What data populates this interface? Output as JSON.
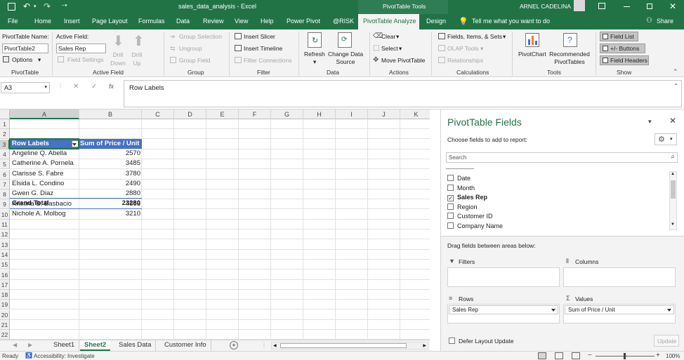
{
  "titlebar": {
    "title": "sales_data_analysis  -  Excel",
    "context": "PivotTable Tools",
    "user": "ARNEL CADELINA"
  },
  "tabs": [
    "File",
    "Home",
    "Insert",
    "Page Layout",
    "Formulas",
    "Data",
    "Review",
    "View",
    "Help",
    "Power Pivot",
    "@RISK",
    "PivotTable Analyze",
    "Design"
  ],
  "active_tab": "PivotTable Analyze",
  "tell_me": "Tell me what you want to do",
  "share": "Share",
  "ribbon": {
    "pivottable": {
      "name_label": "PivotTable Name:",
      "name_value": "PivotTable2",
      "options": "Options",
      "group": "PivotTable"
    },
    "active_field": {
      "label": "Active Field:",
      "value": "Sales Rep",
      "field_settings": "Field Settings",
      "drill_down": "Drill Down",
      "drill_up": "Drill Up",
      "group": "Active Field"
    },
    "group": {
      "group_selection": "Group Selection",
      "ungroup": "Ungroup",
      "group_field": "Group Field",
      "group": "Group"
    },
    "filter": {
      "insert_slicer": "Insert Slicer",
      "insert_timeline": "Insert Timeline",
      "filter_connections": "Filter Connections",
      "group": "Filter"
    },
    "data": {
      "refresh": "Refresh",
      "change_source": "Change Data Source",
      "group": "Data"
    },
    "actions": {
      "clear": "Clear",
      "select": "Select",
      "move": "Move PivotTable",
      "group": "Actions"
    },
    "calculations": {
      "fields_items": "Fields, Items, & Sets",
      "olap": "OLAP Tools",
      "relationships": "Relationships",
      "group": "Calculations"
    },
    "tools": {
      "pivotchart": "PivotChart",
      "recommended": "Recommended PivotTables",
      "group": "Tools"
    },
    "show": {
      "field_list": "Field List",
      "buttons": "+/- Buttons",
      "headers": "Field Headers",
      "group": "Show"
    }
  },
  "formula_bar": {
    "name_box": "A3",
    "fx": "fx",
    "content": "Row Labels"
  },
  "grid": {
    "columns": [
      "A",
      "B",
      "C",
      "D",
      "E",
      "F",
      "G",
      "H",
      "I",
      "J",
      "K"
    ],
    "rows": [
      "1",
      "2",
      "3",
      "4",
      "5",
      "6",
      "7",
      "8",
      "9",
      "10",
      "11",
      "12",
      "13",
      "14",
      "15",
      "16",
      "17",
      "18",
      "19",
      "20",
      "21",
      "22"
    ],
    "pivot_header": {
      "row_labels": "Row Labels",
      "values": "Sum of Price / Unit"
    },
    "pivot_rows": [
      {
        "label": "Angeline Q. Abella",
        "value": "2570"
      },
      {
        "label": "Catherine A. Pornela",
        "value": "3485"
      },
      {
        "label": "Clarisse S. Fabre",
        "value": "3780"
      },
      {
        "label": "Elsida L. Condino",
        "value": "2490"
      },
      {
        "label": "Gwen G. Diaz",
        "value": "2880"
      },
      {
        "label": "Kristina B. Basbacio",
        "value": "4865"
      },
      {
        "label": "Nichole A. Molbog",
        "value": "3210"
      }
    ],
    "grand_total": {
      "label": "Grand Total",
      "value": "23280"
    }
  },
  "sheet_tabs": [
    "Sheet1",
    "Sheet2",
    "Sales Data",
    "Customer Info"
  ],
  "active_sheet": "Sheet2",
  "status": {
    "ready": "Ready",
    "accessibility": "Accessibility: Investigate",
    "zoom": "100%"
  },
  "pivot_pane": {
    "title": "PivotTable Fields",
    "subtitle": "Choose fields to add to report:",
    "search_placeholder": "Search",
    "fields": [
      {
        "name": "Date",
        "checked": false
      },
      {
        "name": "Month",
        "checked": false
      },
      {
        "name": "Sales Rep",
        "checked": true
      },
      {
        "name": "Region",
        "checked": false
      },
      {
        "name": "Customer ID",
        "checked": false
      },
      {
        "name": "Company Name",
        "checked": false
      }
    ],
    "drag_label": "Drag fields between areas below:",
    "filters": "Filters",
    "columns": "Columns",
    "rows": "Rows",
    "values": "Values",
    "rows_chip": "Sales Rep",
    "values_chip": "Sum of Price / Unit",
    "defer": "Defer Layout Update",
    "update": "Update"
  },
  "colors": {
    "excel_green": "#217346",
    "pivot_header": "#4472c4",
    "active_tab_bg": "#ffffff"
  }
}
